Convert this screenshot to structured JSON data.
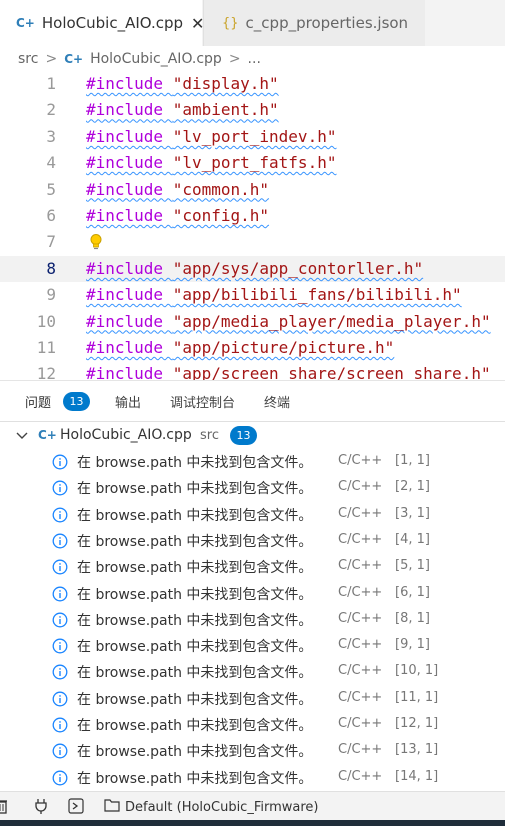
{
  "tabs": [
    {
      "label": "HoloCubic_AIO.cpp",
      "icon": "cpp-file-icon",
      "glyph": "C+",
      "active": true,
      "close_glyph": "✕"
    },
    {
      "label": "c_cpp_properties.json",
      "icon": "json-file-icon",
      "glyph": "{}",
      "active": false
    }
  ],
  "breadcrumb": {
    "folder": "src",
    "file": "HoloCubic_AIO.cpp",
    "file_glyph": "C+",
    "separator": ">",
    "tail": "..."
  },
  "editor": {
    "current_line": 8,
    "lines": [
      {
        "n": "1",
        "kw": "#include",
        "str": "\"display.h\""
      },
      {
        "n": "2",
        "kw": "#include",
        "str": "\"ambient.h\""
      },
      {
        "n": "3",
        "kw": "#include",
        "str": "\"lv_port_indev.h\""
      },
      {
        "n": "4",
        "kw": "#include",
        "str": "\"lv_port_fatfs.h\""
      },
      {
        "n": "5",
        "kw": "#include",
        "str": "\"common.h\""
      },
      {
        "n": "6",
        "kw": "#include",
        "str": "\"config.h\""
      },
      {
        "n": "7",
        "kw": "",
        "str": "",
        "lightbulb": true
      },
      {
        "n": "8",
        "kw": "#include",
        "str": "\"app/sys/app_contorller.h\""
      },
      {
        "n": "9",
        "kw": "#include",
        "str": "\"app/bilibili_fans/bilibili.h\""
      },
      {
        "n": "10",
        "kw": "#include",
        "str": "\"app/media_player/media_player.h\""
      },
      {
        "n": "11",
        "kw": "#include",
        "str": "\"app/picture/picture.h\""
      },
      {
        "n": "12",
        "kw": "#include",
        "str": "\"app/screen_share/screen_share.h\""
      }
    ]
  },
  "panel": {
    "tabs": [
      {
        "label": "问题",
        "badge": "13",
        "active": true
      },
      {
        "label": "输出"
      },
      {
        "label": "调试控制台"
      },
      {
        "label": "终端"
      }
    ],
    "group": {
      "file": "HoloCubic_AIO.cpp",
      "glyph": "C+",
      "dir": "src",
      "count": "13"
    },
    "problems": [
      {
        "message": "在 browse.path 中未找到包含文件。",
        "source": "C/C++",
        "position": "[1, 1]"
      },
      {
        "message": "在 browse.path 中未找到包含文件。",
        "source": "C/C++",
        "position": "[2, 1]"
      },
      {
        "message": "在 browse.path 中未找到包含文件。",
        "source": "C/C++",
        "position": "[3, 1]"
      },
      {
        "message": "在 browse.path 中未找到包含文件。",
        "source": "C/C++",
        "position": "[4, 1]"
      },
      {
        "message": "在 browse.path 中未找到包含文件。",
        "source": "C/C++",
        "position": "[5, 1]"
      },
      {
        "message": "在 browse.path 中未找到包含文件。",
        "source": "C/C++",
        "position": "[6, 1]"
      },
      {
        "message": "在 browse.path 中未找到包含文件。",
        "source": "C/C++",
        "position": "[8, 1]"
      },
      {
        "message": "在 browse.path 中未找到包含文件。",
        "source": "C/C++",
        "position": "[9, 1]"
      },
      {
        "message": "在 browse.path 中未找到包含文件。",
        "source": "C/C++",
        "position": "[10, 1]"
      },
      {
        "message": "在 browse.path 中未找到包含文件。",
        "source": "C/C++",
        "position": "[11, 1]"
      },
      {
        "message": "在 browse.path 中未找到包含文件。",
        "source": "C/C++",
        "position": "[12, 1]"
      },
      {
        "message": "在 browse.path 中未找到包含文件。",
        "source": "C/C++",
        "position": "[13, 1]"
      },
      {
        "message": "在 browse.path 中未找到包含文件。",
        "source": "C/C++",
        "position": "[14, 1]"
      }
    ]
  },
  "statusbar": {
    "env_label": "Default (HoloCubic_Firmware)"
  },
  "colors": {
    "keyword": "#af00db",
    "string": "#a31515",
    "info": "#1a85ff",
    "badge": "#007acc",
    "squiggle": "#3794ff"
  }
}
